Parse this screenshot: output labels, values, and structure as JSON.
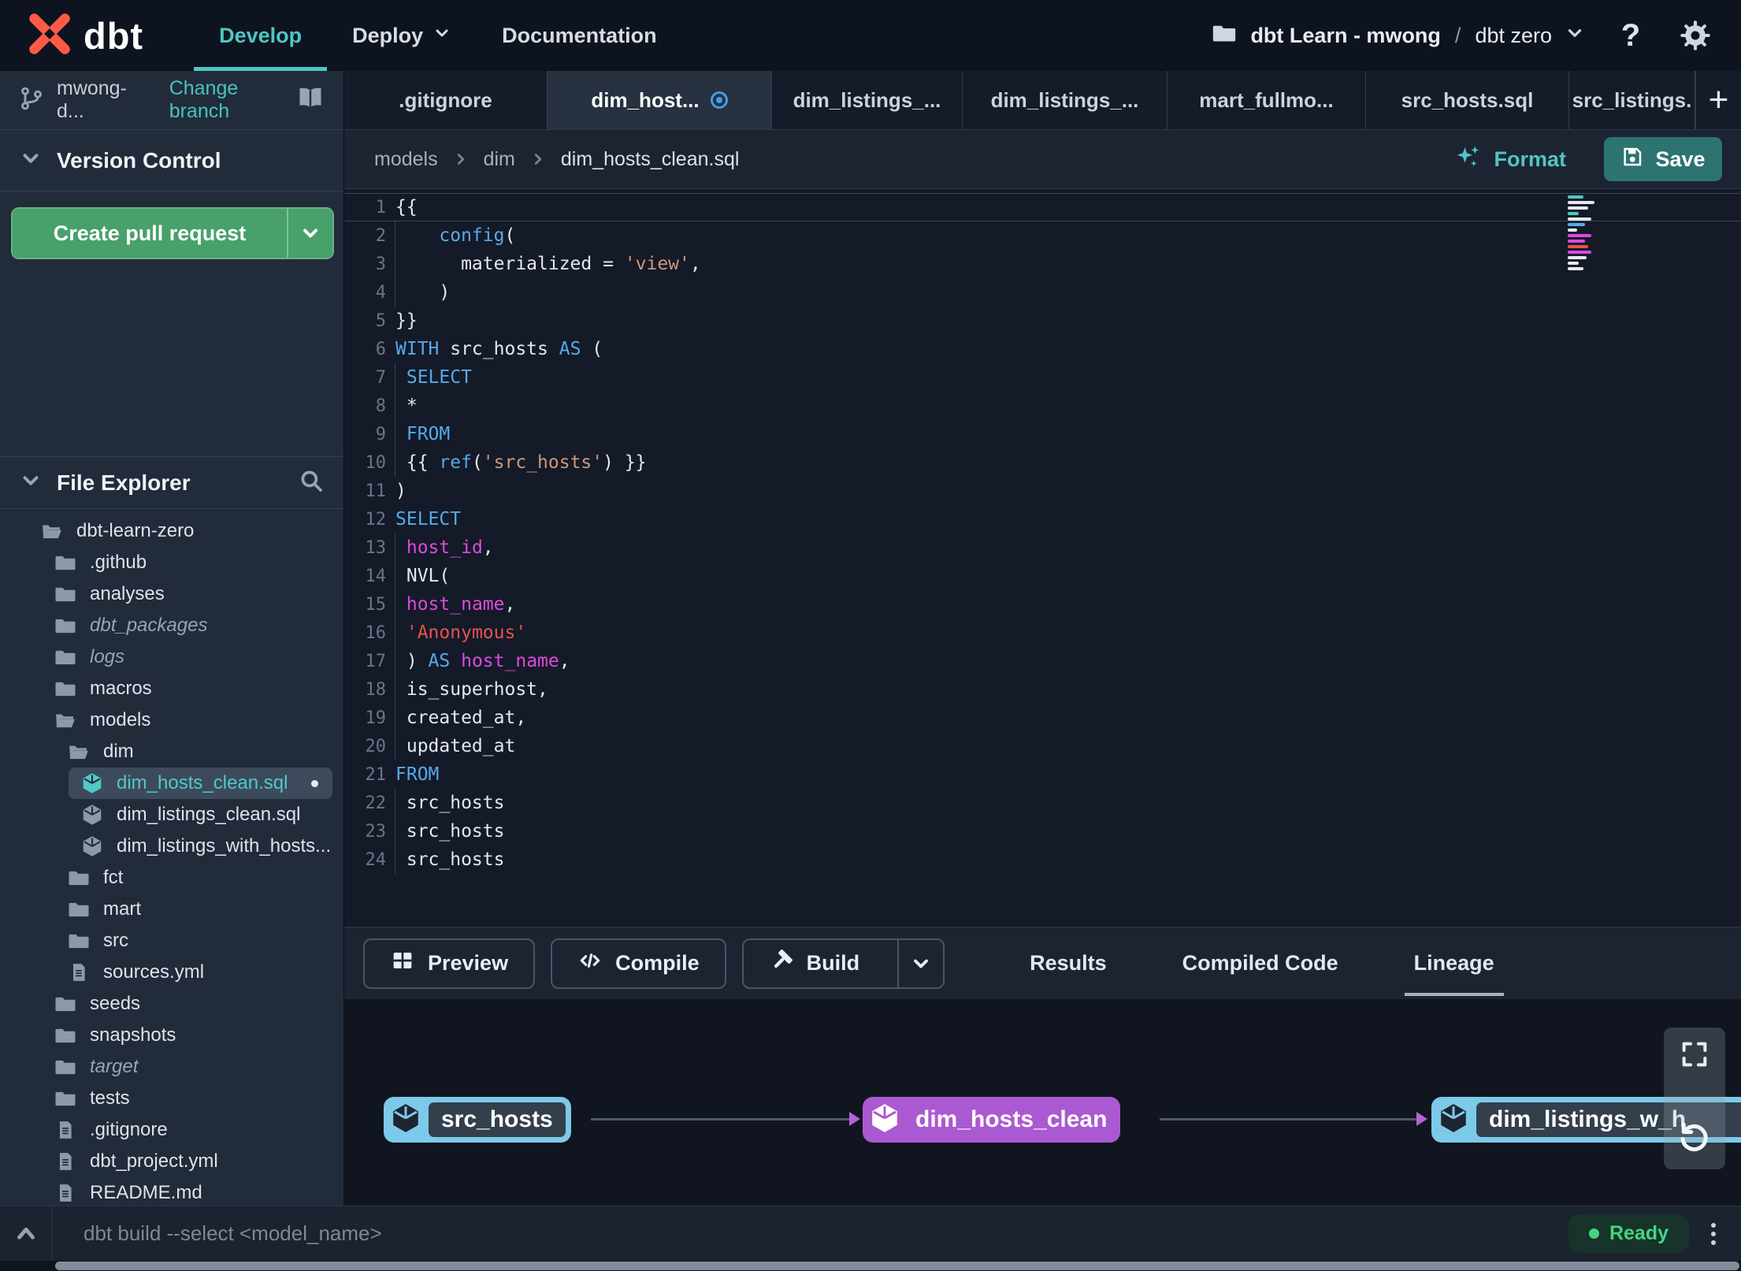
{
  "topnav": {
    "brand": "dbt",
    "nav": [
      {
        "label": "Develop",
        "active": true
      },
      {
        "label": "Deploy",
        "has_dropdown": true
      },
      {
        "label": "Documentation"
      }
    ],
    "account": "dbt Learn - mwong",
    "separator": "/",
    "project": "dbt zero",
    "help_label": "?"
  },
  "sidebar": {
    "branch": {
      "name": "mwong-d...",
      "change_label": "Change branch"
    },
    "version_control": {
      "title": "Version Control",
      "button_label": "Create pull request"
    },
    "file_explorer": {
      "title": "File Explorer"
    },
    "tree": [
      {
        "label": "dbt-learn-zero",
        "icon": "folder-open",
        "level": 0
      },
      {
        "label": ".github",
        "icon": "folder",
        "level": 1
      },
      {
        "label": "analyses",
        "icon": "folder",
        "level": 1
      },
      {
        "label": "dbt_packages",
        "icon": "folder",
        "level": 1,
        "italic": true
      },
      {
        "label": "logs",
        "icon": "folder",
        "level": 1,
        "italic": true
      },
      {
        "label": "macros",
        "icon": "folder",
        "level": 1
      },
      {
        "label": "models",
        "icon": "folder-open",
        "level": 1
      },
      {
        "label": "dim",
        "icon": "folder-open",
        "level": 2
      },
      {
        "label": "dim_hosts_clean.sql",
        "icon": "model",
        "level": 3,
        "selected": true,
        "modified": true
      },
      {
        "label": "dim_listings_clean.sql",
        "icon": "model",
        "level": 3
      },
      {
        "label": "dim_listings_with_hosts...",
        "icon": "model",
        "level": 3
      },
      {
        "label": "fct",
        "icon": "folder",
        "level": 2
      },
      {
        "label": "mart",
        "icon": "folder",
        "level": 2
      },
      {
        "label": "src",
        "icon": "folder",
        "level": 2
      },
      {
        "label": "sources.yml",
        "icon": "file",
        "level": 2
      },
      {
        "label": "seeds",
        "icon": "folder",
        "level": 1
      },
      {
        "label": "snapshots",
        "icon": "folder",
        "level": 1
      },
      {
        "label": "target",
        "icon": "folder",
        "level": 1,
        "italic": true
      },
      {
        "label": "tests",
        "icon": "folder",
        "level": 1
      },
      {
        "label": ".gitignore",
        "icon": "file",
        "level": 1
      },
      {
        "label": "dbt_project.yml",
        "icon": "file",
        "level": 1
      },
      {
        "label": "README.md",
        "icon": "file",
        "level": 1
      }
    ]
  },
  "tabs": [
    {
      "label": ".gitignore"
    },
    {
      "label": "dim_host...",
      "active": true,
      "modified": true
    },
    {
      "label": "dim_listings_..."
    },
    {
      "label": "dim_listings_..."
    },
    {
      "label": "mart_fullmo..."
    },
    {
      "label": "src_hosts.sql"
    },
    {
      "label": "src_listings."
    }
  ],
  "editor_header": {
    "breadcrumb": [
      "models",
      "dim",
      "dim_hosts_clean.sql"
    ],
    "format_label": "Format",
    "save_label": "Save"
  },
  "editor": {
    "lines": [
      {
        "n": 1,
        "cur": true,
        "t": [
          [
            "{{",
            "p"
          ]
        ]
      },
      {
        "n": 2,
        "g": true,
        "t": [
          [
            "    ",
            "p"
          ],
          [
            "config",
            "k"
          ],
          [
            "(",
            "p"
          ]
        ]
      },
      {
        "n": 3,
        "g": true,
        "t": [
          [
            "      materialized = ",
            "p"
          ],
          [
            "'view'",
            "s"
          ],
          [
            ",",
            "p"
          ]
        ]
      },
      {
        "n": 4,
        "g": true,
        "t": [
          [
            "    )",
            "p"
          ]
        ]
      },
      {
        "n": 5,
        "t": [
          [
            "}}",
            "p"
          ]
        ]
      },
      {
        "n": 6,
        "t": [
          [
            "WITH",
            "k"
          ],
          [
            " src_hosts ",
            "p"
          ],
          [
            "AS",
            "k"
          ],
          [
            " (",
            "p"
          ]
        ]
      },
      {
        "n": 7,
        "g": true,
        "t": [
          [
            " ",
            "p"
          ],
          [
            "SELECT",
            "k"
          ]
        ]
      },
      {
        "n": 8,
        "g": true,
        "t": [
          [
            " *",
            "p"
          ]
        ]
      },
      {
        "n": 9,
        "g": true,
        "t": [
          [
            " ",
            "p"
          ],
          [
            "FROM",
            "k"
          ]
        ]
      },
      {
        "n": 10,
        "g": true,
        "t": [
          [
            " {{ ",
            "p"
          ],
          [
            "ref",
            "k"
          ],
          [
            "(",
            "p"
          ],
          [
            "'src_hosts'",
            "s"
          ],
          [
            ") }}",
            "p"
          ]
        ]
      },
      {
        "n": 11,
        "t": [
          [
            ")",
            "p"
          ]
        ]
      },
      {
        "n": 12,
        "t": [
          [
            "SELECT",
            "k"
          ]
        ]
      },
      {
        "n": 13,
        "g": true,
        "t": [
          [
            " ",
            "p"
          ],
          [
            "host_id",
            "m"
          ],
          [
            ",",
            "p"
          ]
        ]
      },
      {
        "n": 14,
        "g": true,
        "t": [
          [
            " NVL(",
            "p"
          ]
        ]
      },
      {
        "n": 15,
        "g": true,
        "t": [
          [
            " ",
            "p"
          ],
          [
            "host_name",
            "m"
          ],
          [
            ",",
            "p"
          ]
        ]
      },
      {
        "n": 16,
        "g": true,
        "t": [
          [
            " ",
            "p"
          ],
          [
            "'Anonymous'",
            "r"
          ]
        ]
      },
      {
        "n": 17,
        "g": true,
        "t": [
          [
            " ) ",
            "p"
          ],
          [
            "AS",
            "k"
          ],
          [
            " ",
            "p"
          ],
          [
            "host_name",
            "m"
          ],
          [
            ",",
            "p"
          ]
        ]
      },
      {
        "n": 18,
        "g": true,
        "t": [
          [
            " is_superhost,",
            "p"
          ]
        ]
      },
      {
        "n": 19,
        "g": true,
        "t": [
          [
            " created_at,",
            "p"
          ]
        ]
      },
      {
        "n": 20,
        "g": true,
        "t": [
          [
            " updated_at",
            "p"
          ]
        ]
      },
      {
        "n": 21,
        "t": [
          [
            "FROM",
            "k"
          ]
        ]
      },
      {
        "n": 22,
        "g": true,
        "t": [
          [
            " src_hosts",
            "p"
          ]
        ]
      },
      {
        "n": 23,
        "g": true,
        "t": [
          [
            " src_hosts",
            "p"
          ]
        ]
      },
      {
        "n": 24,
        "g": true,
        "t": [
          [
            " src_hosts",
            "p"
          ]
        ]
      }
    ]
  },
  "bottom_toolbar": {
    "preview_label": "Preview",
    "compile_label": "Compile",
    "build_label": "Build",
    "tabs": [
      {
        "label": "Results"
      },
      {
        "label": "Compiled Code"
      },
      {
        "label": "Lineage",
        "active": true
      }
    ]
  },
  "lineage": {
    "nodes": [
      {
        "label": "src_hosts",
        "color": "blue"
      },
      {
        "label": "dim_hosts_clean",
        "color": "purple"
      },
      {
        "label": "dim_listings_w_h",
        "color": "blue"
      }
    ]
  },
  "statusbar": {
    "command": "dbt build --select <model_name>",
    "status_label": "Ready"
  },
  "colors": {
    "accent_teal": "#4fc6c4",
    "button_green": "#48a06b",
    "save_teal": "#2d7370",
    "node_blue": "#7dc9ea",
    "node_purple": "#ab59d2",
    "ready_green": "#43d483",
    "logo_orange": "#ff5a47",
    "syntax_keyword": "#57a9ea",
    "syntax_string": "#d0977a",
    "syntax_string_alt": "#e5534b",
    "syntax_identifier": "#de49de"
  }
}
